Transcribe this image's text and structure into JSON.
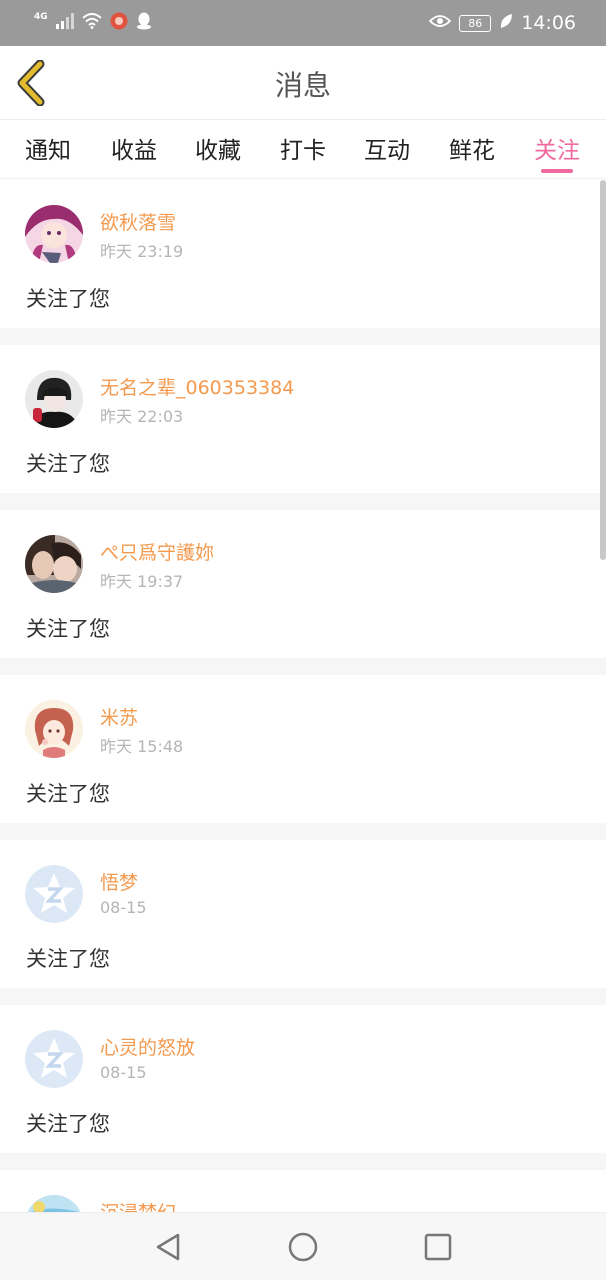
{
  "status_bar": {
    "network": "4G",
    "battery": "86",
    "time": "14:06",
    "icons": [
      "signal-icon",
      "wifi-icon",
      "notification-app-icon",
      "qq-icon",
      "eye-icon",
      "leaf-icon"
    ]
  },
  "header": {
    "title": "消息",
    "back_icon": "chevron-left-icon",
    "accent_color": "#e2bb2e"
  },
  "tabs": [
    {
      "label": "通知",
      "active": false
    },
    {
      "label": "收益",
      "active": false
    },
    {
      "label": "收藏",
      "active": false
    },
    {
      "label": "打卡",
      "active": false
    },
    {
      "label": "互动",
      "active": false
    },
    {
      "label": "鲜花",
      "active": false
    },
    {
      "label": "关注",
      "active": true
    }
  ],
  "colors": {
    "active_tab": "#f06aa0",
    "username": "#f39a4f",
    "timestamp": "#b5b5b5",
    "default_avatar": "#dce8f5"
  },
  "messages": [
    {
      "username": "欲秋落雪",
      "time": "昨天 23:19",
      "action": "关注了您",
      "avatar": "anime-girl-avatar"
    },
    {
      "username": "无名之辈_060353384",
      "time": "昨天 22:03",
      "action": "关注了您",
      "avatar": "dark-anime-avatar"
    },
    {
      "username": "ぺ只爲守護妳",
      "time": "昨天 19:37",
      "action": "关注了您",
      "avatar": "couple-photo-avatar"
    },
    {
      "username": "米苏",
      "time": "昨天 15:48",
      "action": "关注了您",
      "avatar": "cartoon-girl-avatar"
    },
    {
      "username": "悟梦",
      "time": "08-15",
      "action": "关注了您",
      "avatar": "default-star-avatar"
    },
    {
      "username": "心灵的怒放",
      "time": "08-15",
      "action": "关注了您",
      "avatar": "default-star-avatar"
    },
    {
      "username": "沉浸梦幻",
      "time": "",
      "action": "",
      "avatar": "sky-avatar"
    }
  ],
  "navbar": {
    "icons": [
      "back-triangle-icon",
      "home-circle-icon",
      "recents-square-icon"
    ]
  }
}
